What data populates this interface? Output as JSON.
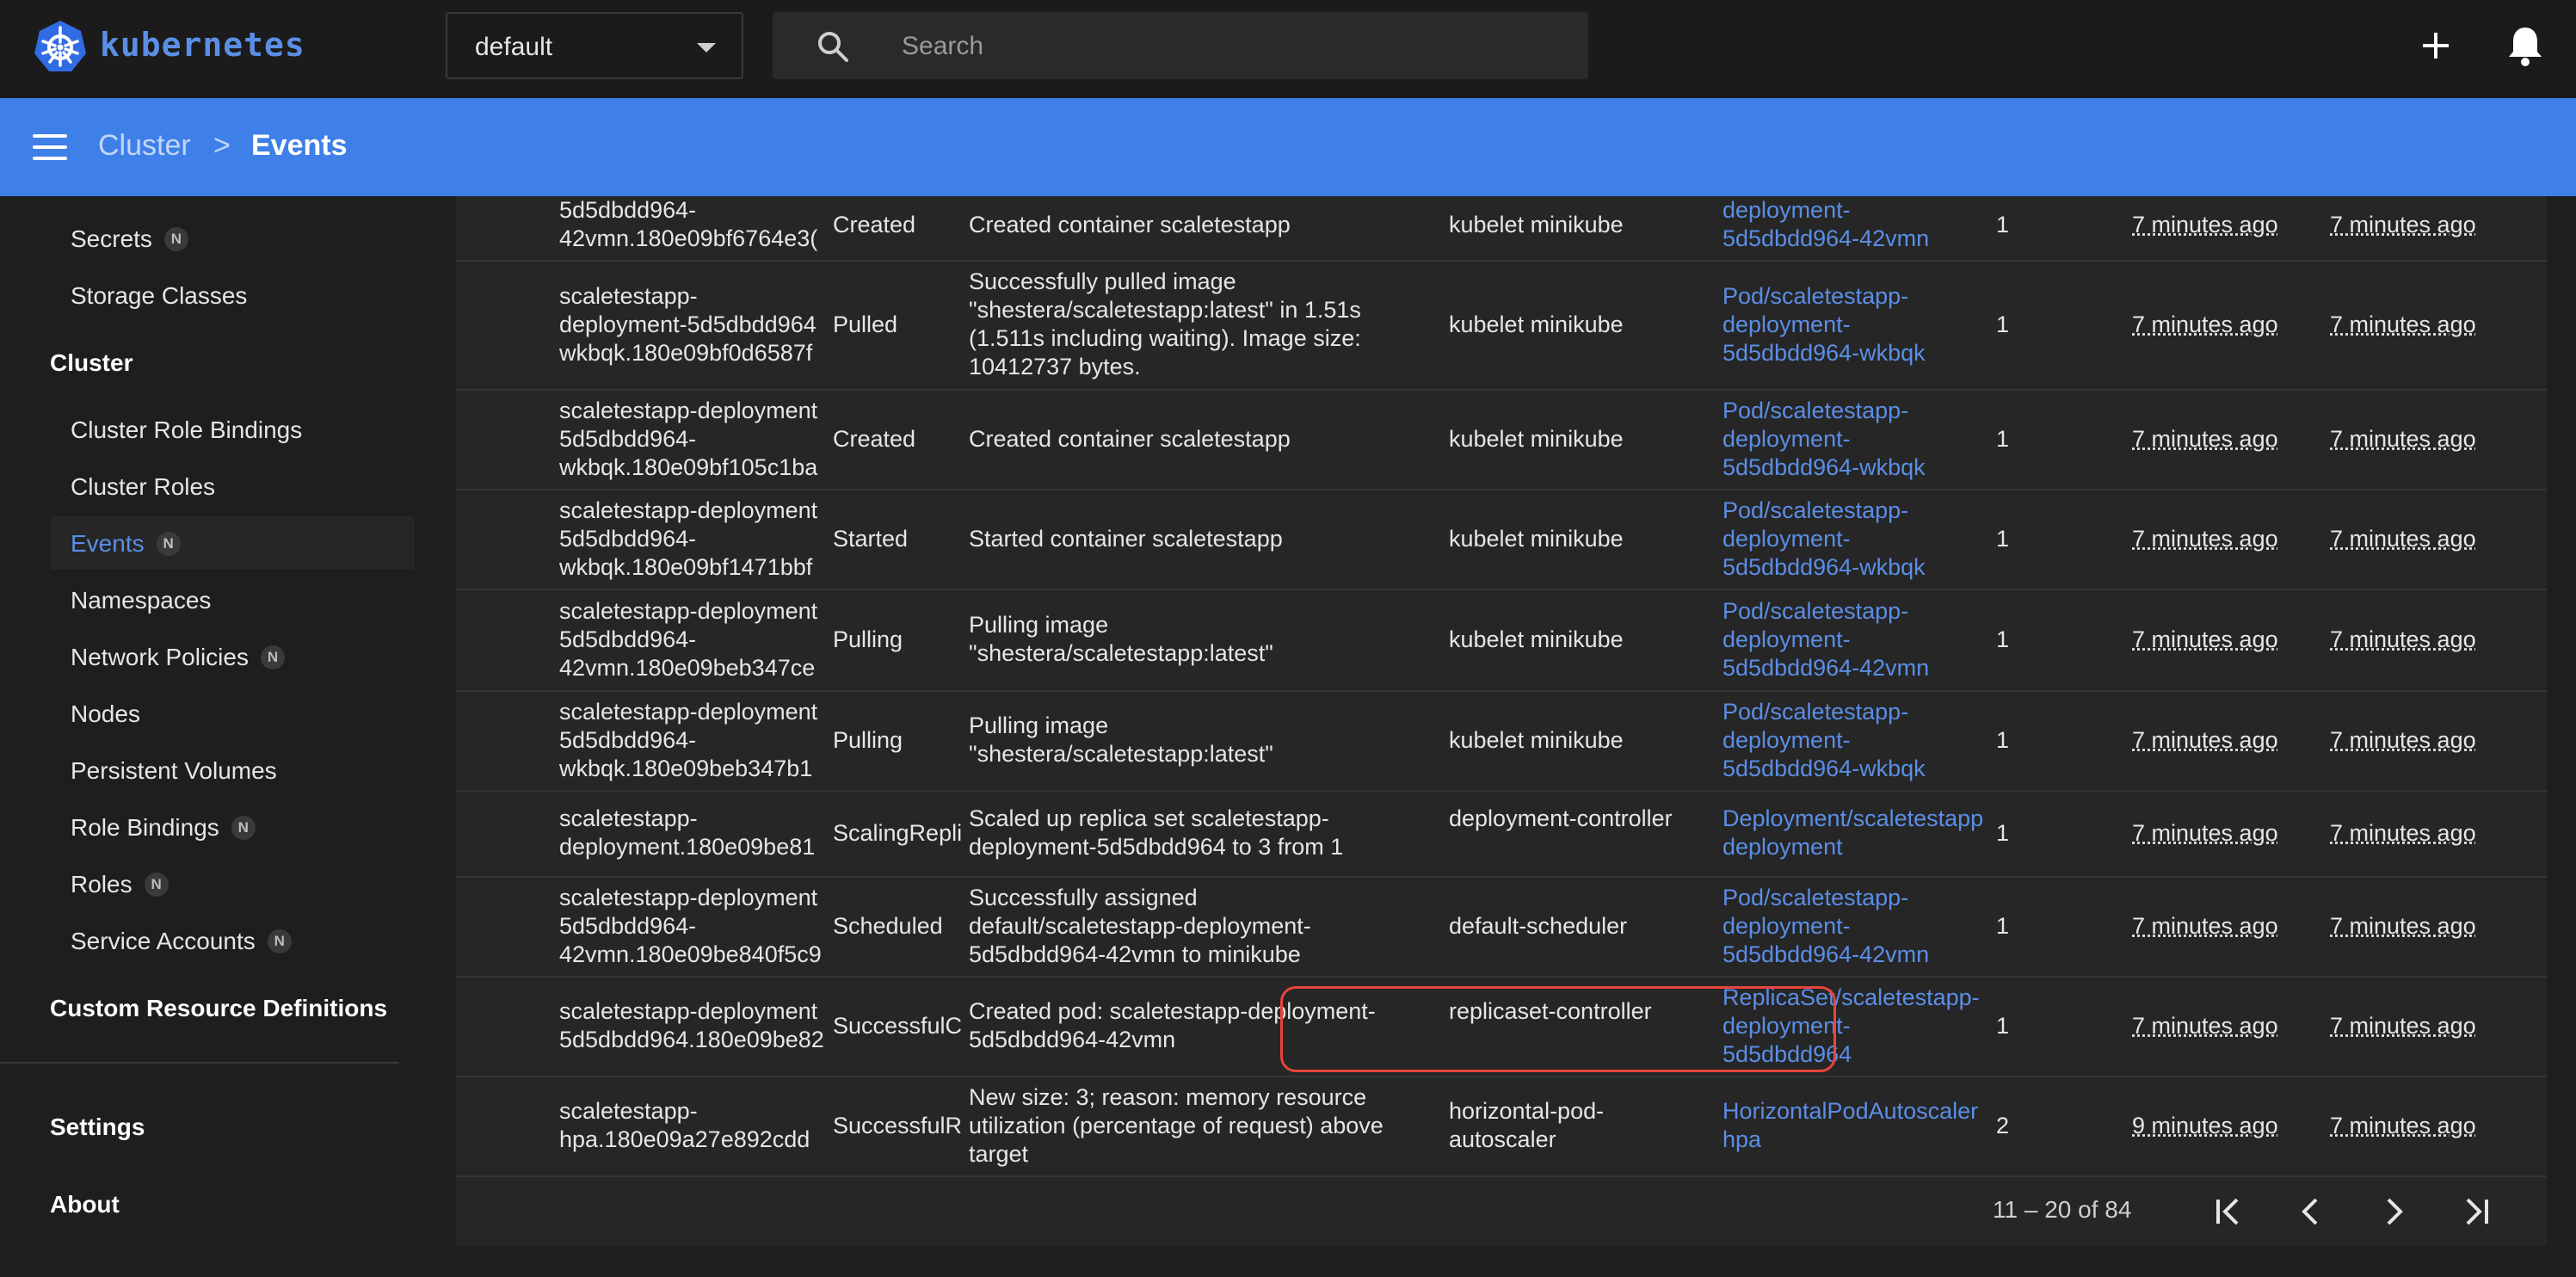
{
  "app": {
    "brand": "kubernetes"
  },
  "namespace_select": {
    "value": "default"
  },
  "search": {
    "placeholder": "Search"
  },
  "breadcrumb": {
    "parent": "Cluster",
    "separator": ">",
    "current": "Events"
  },
  "sidebar": {
    "top_items": [
      {
        "label": "Secrets",
        "badge": "N"
      },
      {
        "label": "Storage Classes",
        "badge": ""
      }
    ],
    "cluster_heading": "Cluster",
    "cluster_items": [
      {
        "label": "Cluster Role Bindings",
        "badge": ""
      },
      {
        "label": "Cluster Roles",
        "badge": ""
      },
      {
        "label": "Events",
        "badge": "N"
      },
      {
        "label": "Namespaces",
        "badge": ""
      },
      {
        "label": "Network Policies",
        "badge": "N"
      },
      {
        "label": "Nodes",
        "badge": ""
      },
      {
        "label": "Persistent Volumes",
        "badge": ""
      },
      {
        "label": "Role Bindings",
        "badge": "N"
      },
      {
        "label": "Roles",
        "badge": "N"
      },
      {
        "label": "Service Accounts",
        "badge": "N"
      }
    ],
    "crd": "Custom Resource Definitions",
    "settings": "Settings",
    "about": "About"
  },
  "events": [
    {
      "name": [
        "5d5dbdd964-",
        "42vmn.180e09bf6764e3("
      ],
      "reason": "Created",
      "message": "Created container scaletestapp",
      "source": "kubelet minikube",
      "object": [
        "deployment-",
        "5d5dbdd964-42vmn"
      ],
      "count": "1",
      "first": "7 minutes ago",
      "last": "7 minutes ago"
    },
    {
      "name": [
        "scaletestapp-",
        "deployment-5d5dbdd964",
        "wkbqk.180e09bf0d6587f"
      ],
      "reason": "Pulled",
      "message": "Successfully pulled image \"shestera/scaletestapp:latest\" in 1.51s (1.511s including waiting). Image size: 10412737 bytes.",
      "source": "kubelet minikube",
      "object": [
        "Pod/scaletestapp-",
        "deployment-",
        "5d5dbdd964-wkbqk"
      ],
      "count": "1",
      "first": "7 minutes ago",
      "last": "7 minutes ago"
    },
    {
      "name": [
        "scaletestapp-deployment",
        "5d5dbdd964-",
        "wkbqk.180e09bf105c1ba"
      ],
      "reason": "Created",
      "message": "Created container scaletestapp",
      "source": "kubelet minikube",
      "object": [
        "Pod/scaletestapp-",
        "deployment-",
        "5d5dbdd964-wkbqk"
      ],
      "count": "1",
      "first": "7 minutes ago",
      "last": "7 minutes ago"
    },
    {
      "name": [
        "scaletestapp-deployment",
        "5d5dbdd964-",
        "wkbqk.180e09bf1471bbf"
      ],
      "reason": "Started",
      "message": "Started container scaletestapp",
      "source": "kubelet minikube",
      "object": [
        "Pod/scaletestapp-",
        "deployment-",
        "5d5dbdd964-wkbqk"
      ],
      "count": "1",
      "first": "7 minutes ago",
      "last": "7 minutes ago"
    },
    {
      "name": [
        "scaletestapp-deployment",
        "5d5dbdd964-",
        "42vmn.180e09beb347ce"
      ],
      "reason": "Pulling",
      "message": "Pulling image \"shestera/scaletestapp:latest\"",
      "source": "kubelet minikube",
      "object": [
        "Pod/scaletestapp-",
        "deployment-",
        "5d5dbdd964-42vmn"
      ],
      "count": "1",
      "first": "7 minutes ago",
      "last": "7 minutes ago"
    },
    {
      "name": [
        "scaletestapp-deployment",
        "5d5dbdd964-",
        "wkbqk.180e09beb347b1"
      ],
      "reason": "Pulling",
      "message": "Pulling image \"shestera/scaletestapp:latest\"",
      "source": "kubelet minikube",
      "object": [
        "Pod/scaletestapp-",
        "deployment-",
        "5d5dbdd964-wkbqk"
      ],
      "count": "1",
      "first": "7 minutes ago",
      "last": "7 minutes ago"
    },
    {
      "name": [
        "scaletestapp-",
        "deployment.180e09be81"
      ],
      "reason": "ScalingRepli",
      "message": "Scaled up replica set scaletestapp-deployment-5d5dbdd964 to 3 from 1",
      "source": "deployment-controller",
      "object": [
        "Deployment/scaletestapp",
        "deployment"
      ],
      "count": "1",
      "first": "7 minutes ago",
      "last": "7 minutes ago"
    },
    {
      "name": [
        "scaletestapp-deployment",
        "5d5dbdd964-",
        "42vmn.180e09be840f5c9"
      ],
      "reason": "Scheduled",
      "message": "Successfully assigned default/scaletestapp-deployment-5d5dbdd964-42vmn to minikube",
      "source": "default-scheduler",
      "object": [
        "Pod/scaletestapp-",
        "deployment-",
        "5d5dbdd964-42vmn"
      ],
      "count": "1",
      "first": "7 minutes ago",
      "last": "7 minutes ago"
    },
    {
      "name": [
        "scaletestapp-deployment",
        "5d5dbdd964.180e09be82"
      ],
      "reason": "SuccessfulC",
      "message": "Created pod: scaletestapp-deployment-5d5dbdd964-42vmn",
      "source": "replicaset-controller",
      "object": [
        "ReplicaSet/scaletestapp-",
        "deployment-",
        "5d5dbdd964"
      ],
      "count": "1",
      "first": "7 minutes ago",
      "last": "7 minutes ago"
    },
    {
      "name": [
        "scaletestapp-",
        "hpa.180e09a27e892cdd"
      ],
      "reason": "SuccessfulR",
      "message": "New size: 3; reason: memory resource utilization (percentage of request) above target",
      "source": "horizontal-pod-autoscaler",
      "object": [
        "HorizontalPodAutoscaler",
        "hpa"
      ],
      "count": "2",
      "first": "9 minutes ago",
      "last": "7 minutes ago"
    }
  ],
  "pagination": {
    "range": "11 – 20 of 84"
  },
  "colors": {
    "accent": "#3f7fe8",
    "link": "#5b8ee6",
    "highlight": "#e8453c"
  }
}
